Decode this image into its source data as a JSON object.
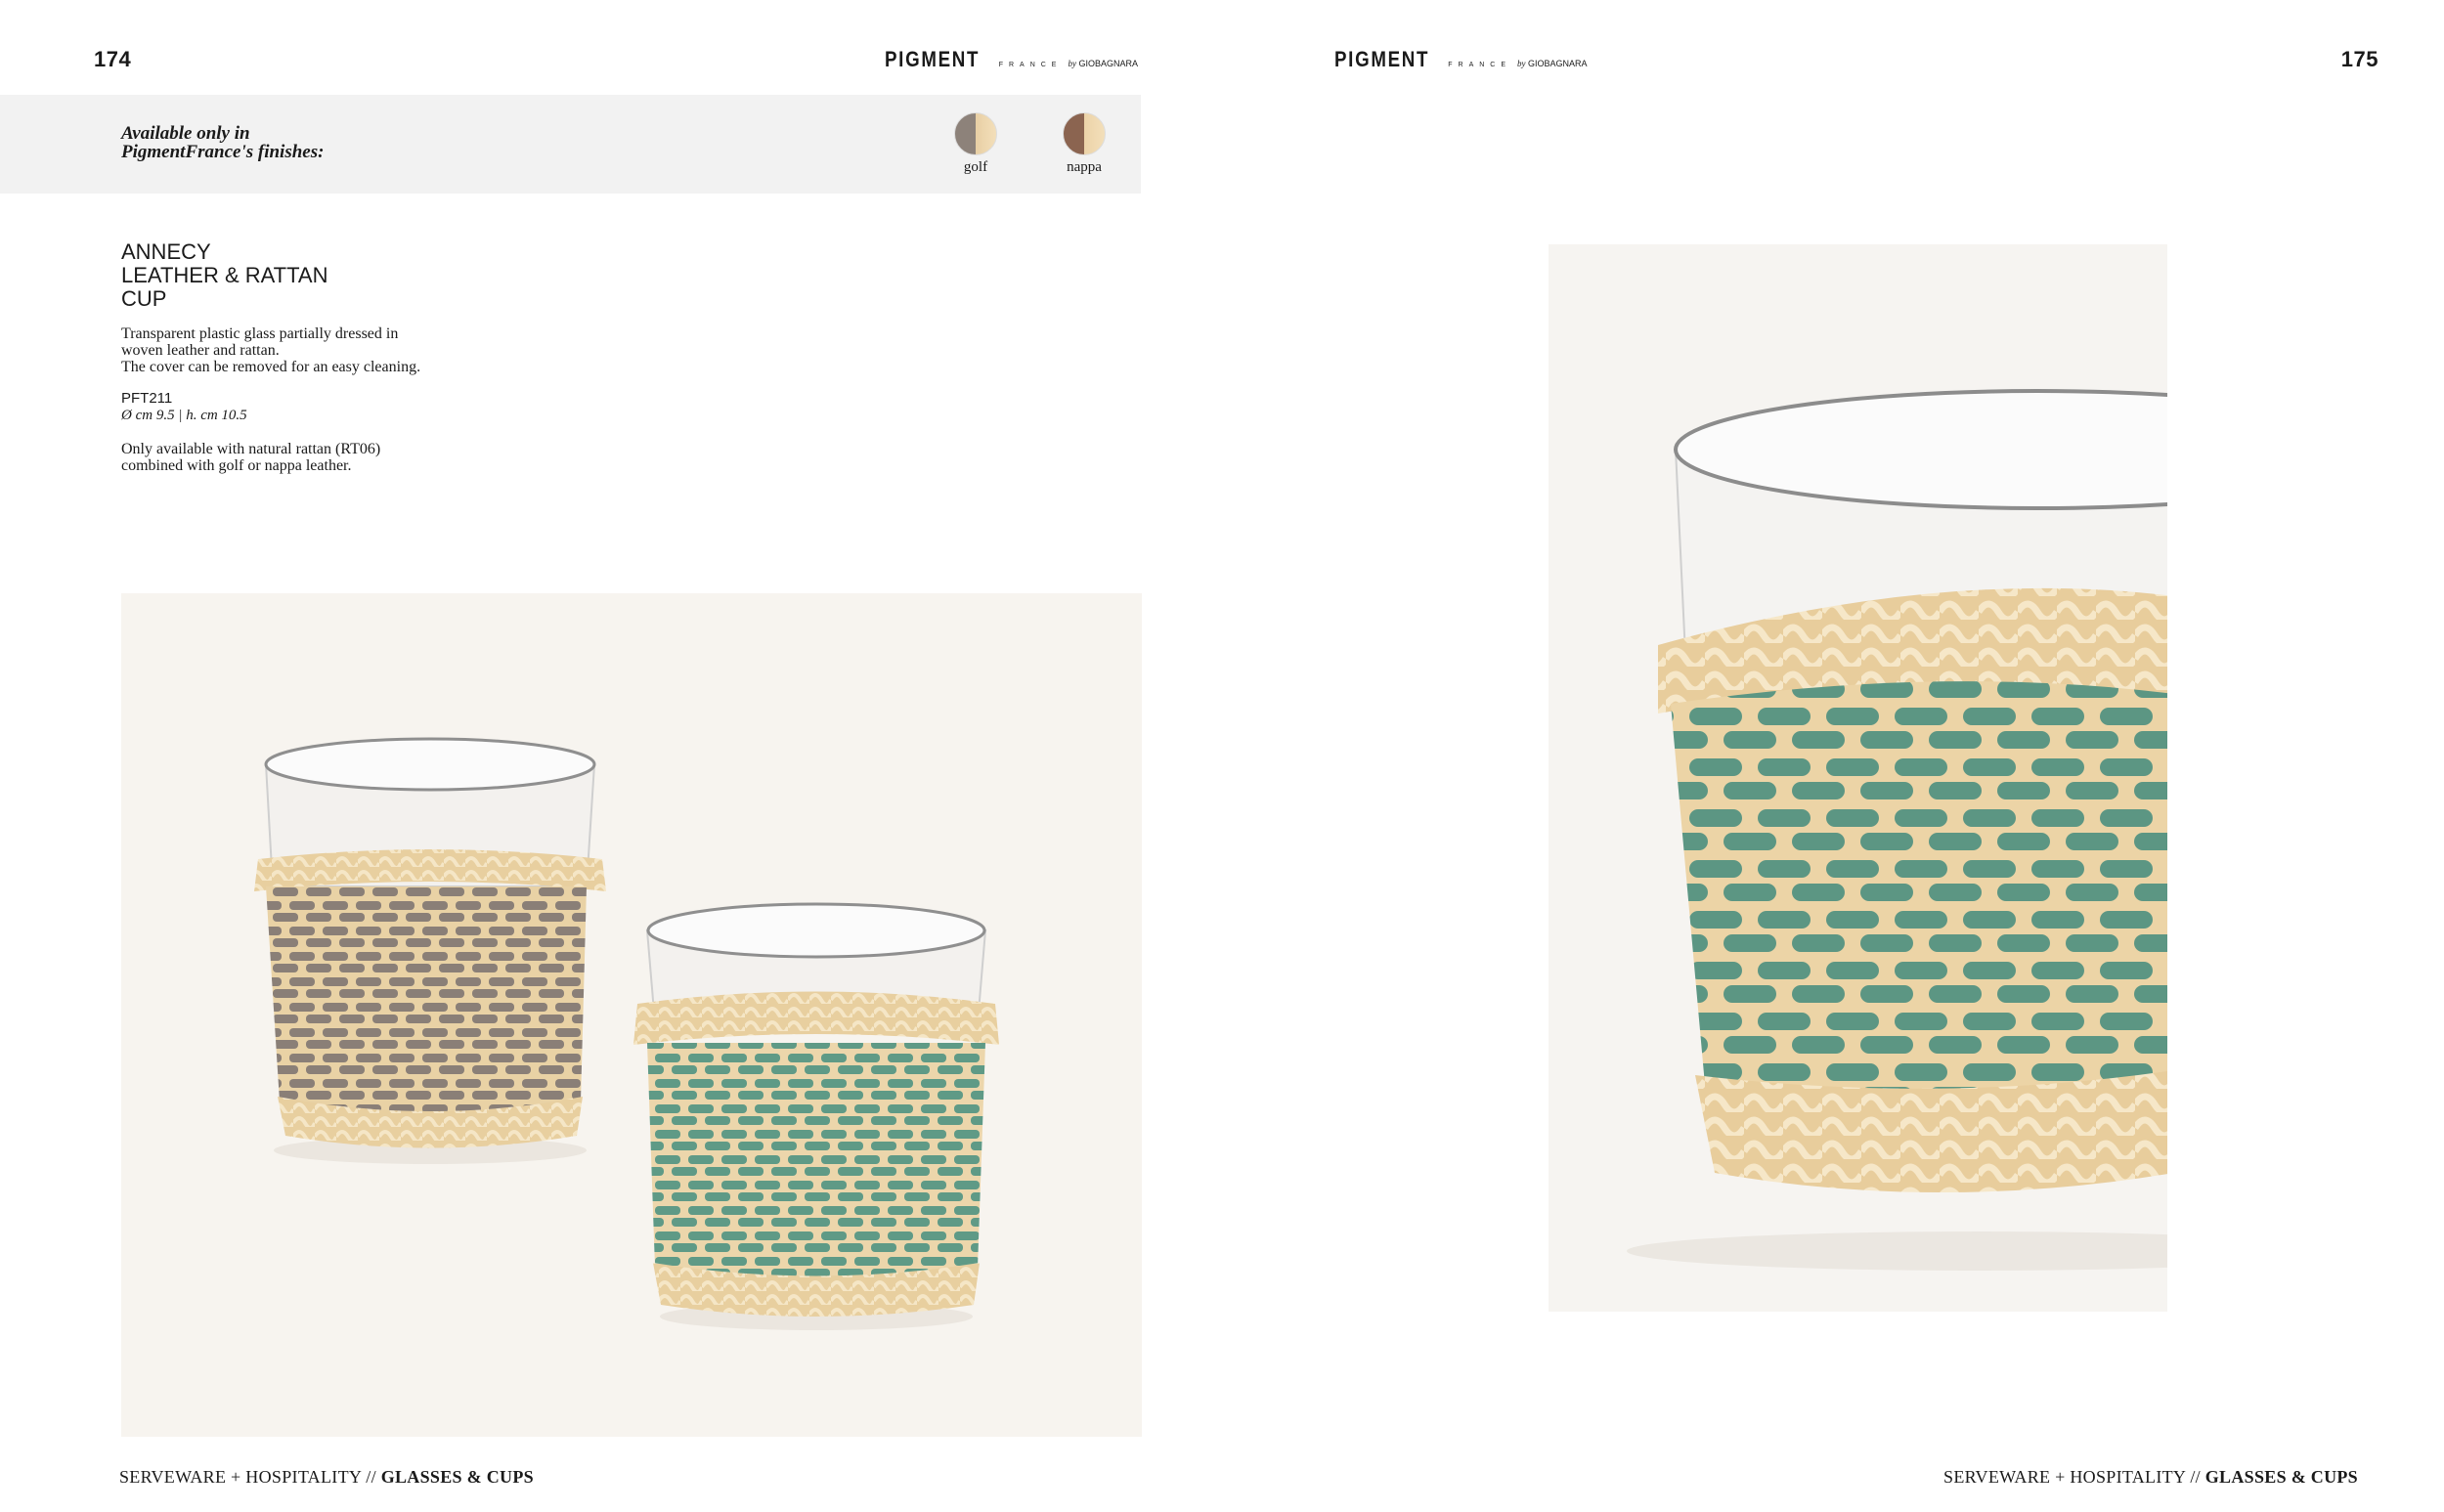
{
  "left_page": {
    "number": "174",
    "brand": {
      "name": "PIGMENT",
      "sub": "FRANCE",
      "by": "by",
      "maker": "GIOBAGNARA"
    },
    "finishes": {
      "label_line1": "Available only in",
      "label_line2": "PigmentFrance's finishes:",
      "swatches": [
        {
          "name": "golf",
          "icon": "golf-finish-swatch"
        },
        {
          "name": "nappa",
          "icon": "nappa-finish-swatch"
        }
      ]
    },
    "product": {
      "title_line1": "ANNECY",
      "title_line2": "LEATHER & RATTAN",
      "title_line3": "CUP",
      "desc_line1": "Transparent plastic glass partially dressed in",
      "desc_line2": "woven leather and rattan.",
      "desc_line3": "The cover can be removed for an easy cleaning.",
      "code": "PFT211",
      "dimensions": "Ø cm 9.5 | h. cm 10.5",
      "note_line1": "Only available with natural rattan (RT06)",
      "note_line2": "combined with golf or nappa leather."
    },
    "footer": {
      "section": "SERVEWARE + HOSPITALITY // ",
      "category": "GLASSES & CUPS"
    }
  },
  "right_page": {
    "number": "175",
    "brand": {
      "name": "PIGMENT",
      "sub": "FRANCE",
      "by": "by",
      "maker": "GIOBAGNARA"
    },
    "footer": {
      "section": "SERVEWARE + HOSPITALITY // ",
      "category": "GLASSES & CUPS"
    }
  },
  "colors": {
    "band": "#f2f2f2",
    "rattan": "#e6cfa3",
    "leather_golf": "#8d827a",
    "leather_green": "#5f9a86"
  }
}
